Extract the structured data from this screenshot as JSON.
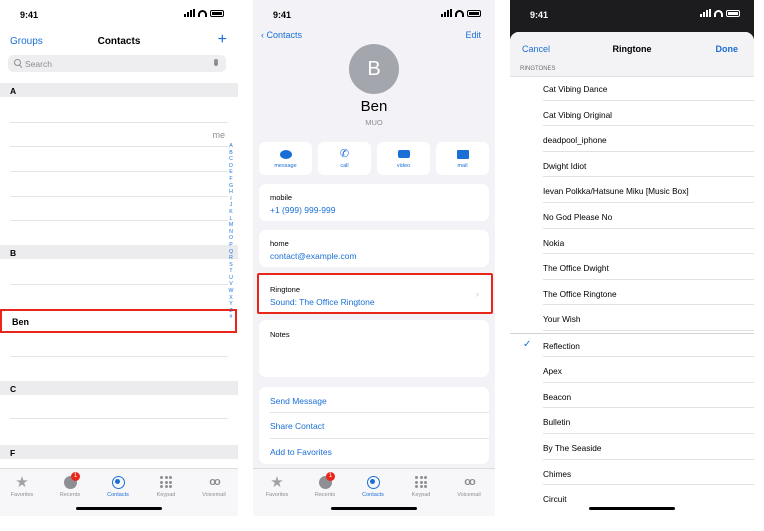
{
  "status": {
    "time": "9:41"
  },
  "contacts_screen": {
    "left_nav": "Groups",
    "title": "Contacts",
    "add_glyph": "+",
    "search_placeholder": "Search",
    "sections": [
      "A",
      "B",
      "C",
      "F"
    ],
    "me_label": "me",
    "highlighted_contact": "Ben",
    "index_letters": [
      "A",
      "B",
      "C",
      "D",
      "E",
      "F",
      "G",
      "H",
      "I",
      "J",
      "K",
      "L",
      "M",
      "N",
      "O",
      "P",
      "Q",
      "R",
      "S",
      "T",
      "U",
      "V",
      "W",
      "X",
      "Y",
      "Z",
      "#"
    ]
  },
  "detail_screen": {
    "back_label": "Contacts",
    "edit_label": "Edit",
    "avatar_initial": "B",
    "name": "Ben",
    "company": "MUO",
    "actions": [
      "message",
      "call",
      "video",
      "mail"
    ],
    "mobile": {
      "label": "mobile",
      "value": "+1 (999) 999-999"
    },
    "home": {
      "label": "home",
      "value": "contact@example.com"
    },
    "ringtone": {
      "label": "Ringtone",
      "value": "Sound: The Office Ringtone"
    },
    "notes_label": "Notes",
    "links": [
      "Send Message",
      "Share Contact",
      "Add to Favorites"
    ]
  },
  "tabbar": {
    "items": [
      "Favorites",
      "Recents",
      "Contacts",
      "Keypad",
      "Voicemail"
    ],
    "active": "Contacts",
    "recents_badge": "1"
  },
  "ringtone_screen": {
    "cancel_label": "Cancel",
    "title": "Ringtone",
    "done_label": "Done",
    "section_header": "RINGTONES",
    "custom_tones": [
      "Cat Vibing Dance",
      "Cat Vibing Original",
      "deadpool_iphone",
      "Dwight Idiot",
      "Ievan Polkka/Hatsune Miku [Music Box]",
      "No God Please No",
      "Nokia",
      "The Office Dwight",
      "The Office Ringtone",
      "Your Wish"
    ],
    "system_tones": [
      "Reflection",
      "Apex",
      "Beacon",
      "Bulletin",
      "By The Seaside",
      "Chimes",
      "Circuit"
    ],
    "selected": "Reflection"
  },
  "colors": {
    "accent": "#1a6fd6",
    "highlight": "#e8271a",
    "badge": "#e8271a"
  }
}
